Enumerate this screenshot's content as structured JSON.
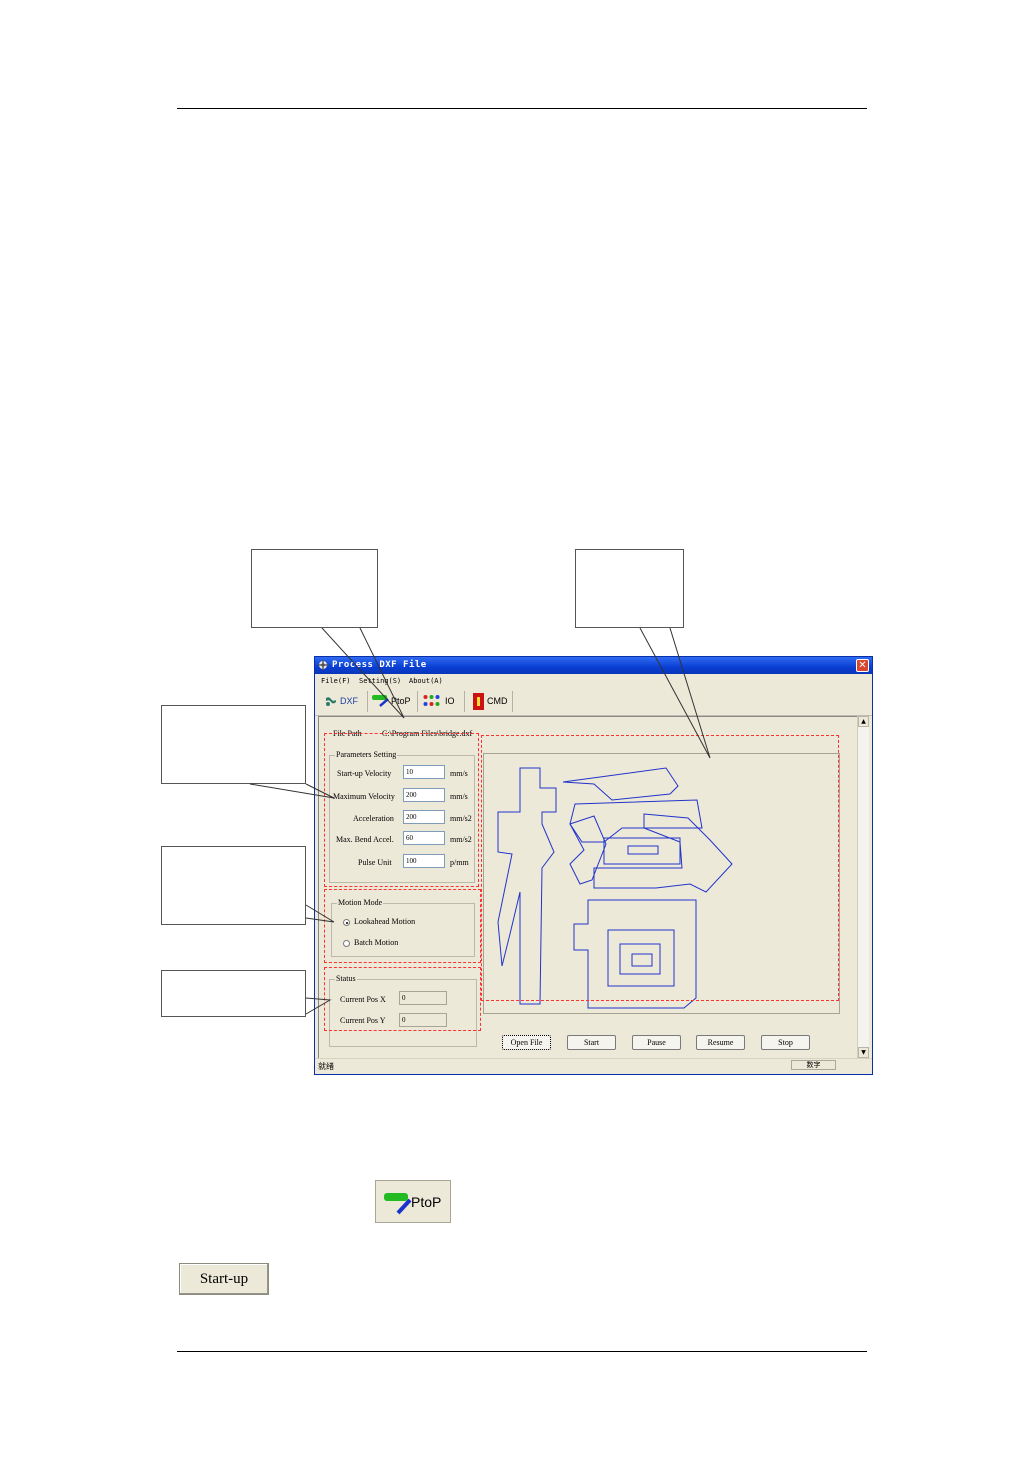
{
  "window": {
    "title": "Process DXF File",
    "close_glyph": "✕",
    "menu": [
      "File(F)",
      "Setting(S)",
      "About(A)"
    ],
    "toolbar": [
      "DXF",
      "PtoP",
      "IO",
      "CMD"
    ]
  },
  "file_path": {
    "label": "File Path",
    "value": "C:\\Program Files\\bridge.dxf"
  },
  "parameters": {
    "group_label": "Parameters Setting",
    "rows": [
      {
        "label": "Start-up Velocity",
        "value": "10",
        "unit": "mm/s"
      },
      {
        "label": "Maximum Velocity",
        "value": "200",
        "unit": "mm/s"
      },
      {
        "label": "Acceleration",
        "value": "200",
        "unit": "mm/s2"
      },
      {
        "label": "Max. Bend Accel.",
        "value": "60",
        "unit": "mm/s2"
      },
      {
        "label": "Pulse Unit",
        "value": "100",
        "unit": "p/mm"
      }
    ]
  },
  "motion_mode": {
    "group_label": "Motion Mode",
    "options": [
      {
        "label": "Lookahead Motion",
        "selected": true
      },
      {
        "label": "Batch Motion",
        "selected": false
      }
    ]
  },
  "status": {
    "group_label": "Status",
    "pos_x_label": "Current Pos  X",
    "pos_x": "0",
    "pos_y_label": "Current Pos  Y",
    "pos_y": "0"
  },
  "buttons": [
    "Open File",
    "Start",
    "Pause",
    "Resume",
    "Stop"
  ],
  "statusbar": {
    "left": "就绪",
    "right": "数字"
  },
  "scroll": {
    "up": "▲",
    "down": "▼"
  },
  "icons": {
    "toolbar_dxf": "dxf-icon",
    "toolbar_ptop": "ptop-icon",
    "toolbar_io": "io-icon",
    "toolbar_cmd": "cmd-icon"
  },
  "lower_buttons": {
    "ptop_label": "PtoP",
    "startup_label": "Start-up"
  },
  "colors": {
    "title_bar": "#0a3fd3",
    "close": "#d9462d",
    "dashed_highlight": "#ff3030",
    "glyph_outline": "#2233cc"
  }
}
